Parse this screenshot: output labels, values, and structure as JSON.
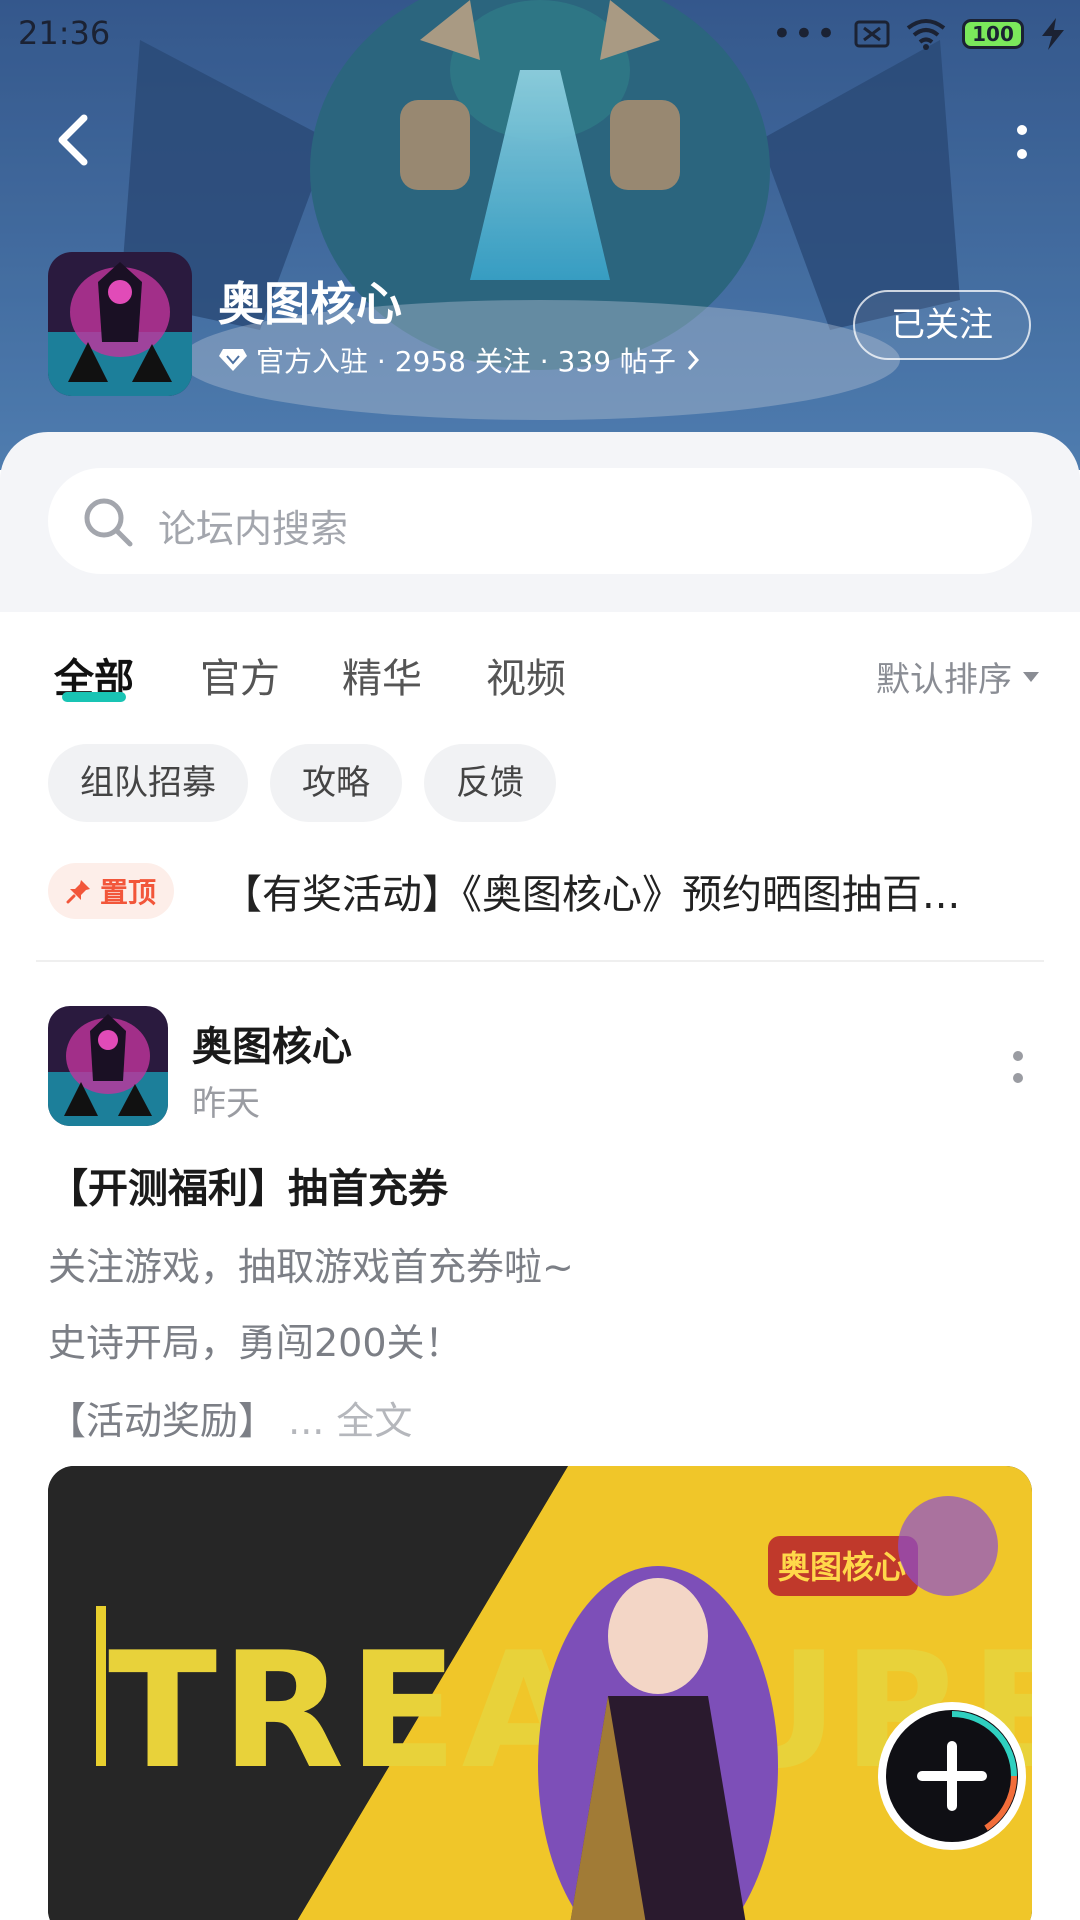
{
  "status_bar": {
    "time": "21:36",
    "battery": "100"
  },
  "forum": {
    "name": "奥图核心",
    "meta": "官方入驻 · 2958 关注 · 339 帖子",
    "follow_label": "已关注"
  },
  "search": {
    "placeholder": "论坛内搜索"
  },
  "tabs": [
    {
      "label": "全部",
      "active": true
    },
    {
      "label": "官方"
    },
    {
      "label": "精华"
    },
    {
      "label": "视频"
    }
  ],
  "sort_label": "默认排序",
  "chips": [
    "组队招募",
    "攻略",
    "反馈"
  ],
  "pinned": {
    "badge": "置顶",
    "title": "【有奖活动】《奥图核心》预约晒图抽百..."
  },
  "post": {
    "author": "奥图核心",
    "time": "昨天",
    "title": "【开测福利】抽首充券",
    "lines": [
      "关注游戏，抽取游戏首充券啦~",
      "史诗开局，勇闯200关！",
      "【活动奖励】"
    ],
    "read_more": "... 全文",
    "image_text": "TREASURE",
    "image_logo": "奥图核心"
  },
  "colors": {
    "accent": "#19c4b4",
    "pin": "#f2563a"
  }
}
